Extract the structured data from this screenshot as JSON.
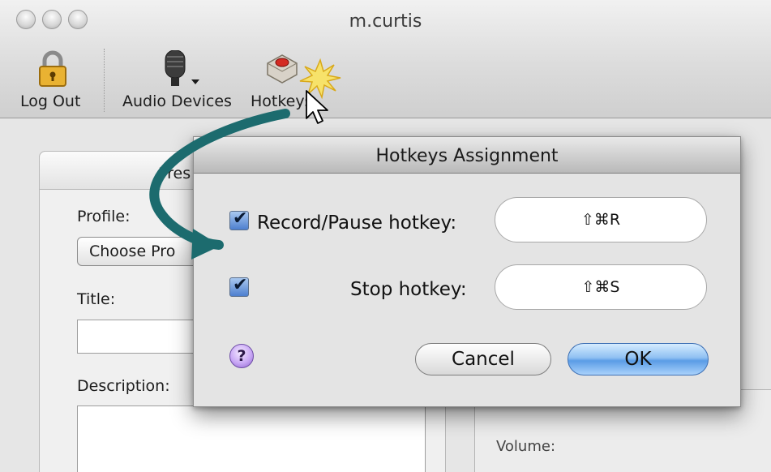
{
  "window": {
    "title": "m.curtis"
  },
  "toolbar": {
    "items": [
      {
        "label": "Log Out",
        "icon": "lock-icon"
      },
      {
        "label": "Audio Devices",
        "icon": "microphone-icon"
      },
      {
        "label": "Hotkeys",
        "icon": "record-button-icon"
      }
    ]
  },
  "background_panel": {
    "tab_label": "Pres",
    "profile_label": "Profile:",
    "choose_profile_button": "Choose Pro",
    "title_label": "Title:",
    "description_label": "Description:",
    "volume_label": "Volume:"
  },
  "dialog": {
    "title": "Hotkeys Assignment",
    "rows": [
      {
        "label": "Record/Pause hotkey:",
        "checked": true,
        "value": "⇧⌘R"
      },
      {
        "label": "Stop hotkey:",
        "checked": true,
        "value": "⇧⌘S"
      }
    ],
    "help_label": "?",
    "cancel_label": "Cancel",
    "ok_label": "OK"
  },
  "colors": {
    "accent_arrow": "#1c6b6e",
    "ok_button": "#5a9ce6",
    "help_button": "#c9a8f5"
  }
}
